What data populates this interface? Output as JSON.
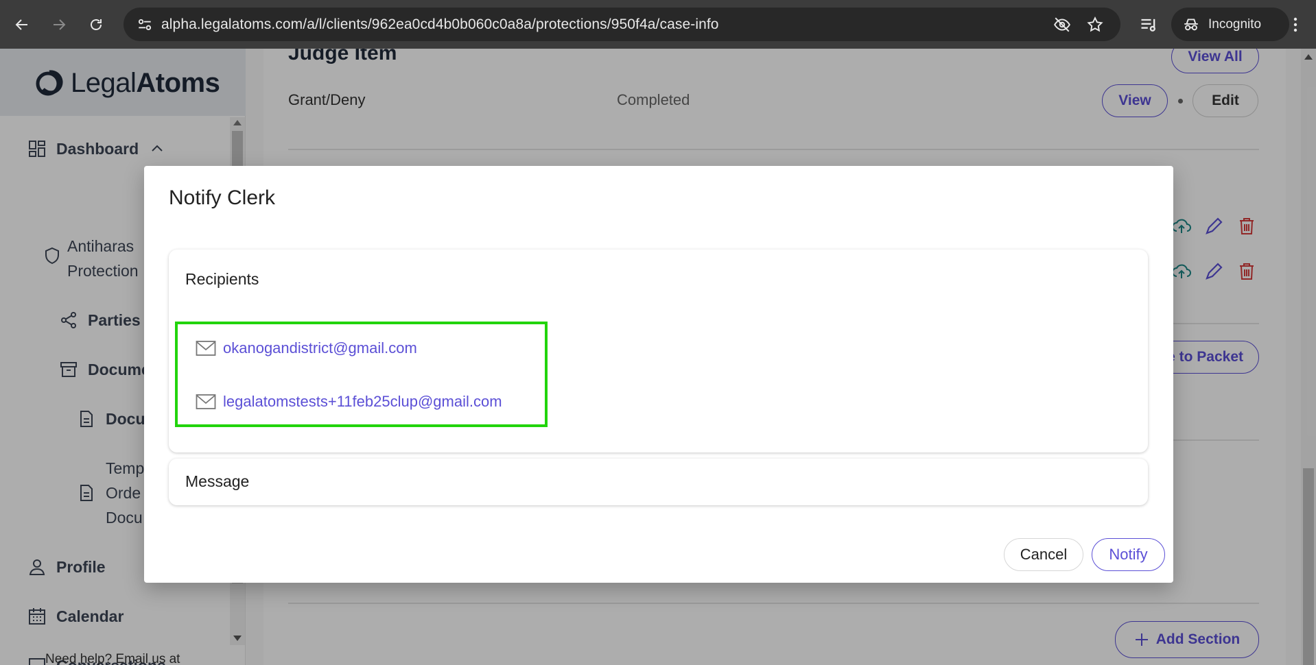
{
  "browser": {
    "url": "alpha.legalatoms.com/a/l/clients/962ea0cd4b0b060c0a8a/protections/950f4a/case-info",
    "incognito_label": "Incognito"
  },
  "sidebar": {
    "logo_prefix": "Legal",
    "logo_suffix": "Atoms",
    "items": [
      {
        "label": "Dashboard"
      },
      {
        "label": "Antiharas",
        "label2": "Protection"
      },
      {
        "label": "Parties"
      },
      {
        "label": "Docume"
      },
      {
        "label": "Docu"
      },
      {
        "label": "Temp",
        "label2": "Orde",
        "label3": "Docu"
      },
      {
        "label": "Profile"
      },
      {
        "label": "Calendar"
      },
      {
        "label": "Conversations"
      }
    ],
    "help_text": "Need help? Email us at"
  },
  "main": {
    "judge_title": "Judge Item",
    "view_all_label": "View All",
    "row_name": "Grant/Deny",
    "row_status": "Completed",
    "view_label": "View",
    "edit_label": "Edit",
    "packet_label": "e to Packet",
    "add_section_label": "Add Section"
  },
  "modal": {
    "title": "Notify Clerk",
    "recipients_title": "Recipients",
    "recipients": [
      "okanogandistrict@gmail.com",
      "legalatomstests+11feb25clup@gmail.com"
    ],
    "message_title": "Message",
    "cancel_label": "Cancel",
    "notify_label": "Notify"
  },
  "colors": {
    "accent": "#5b4fd6",
    "highlight": "#22d40c",
    "delete": "#d63a3a",
    "upload": "#1d8a8a"
  }
}
